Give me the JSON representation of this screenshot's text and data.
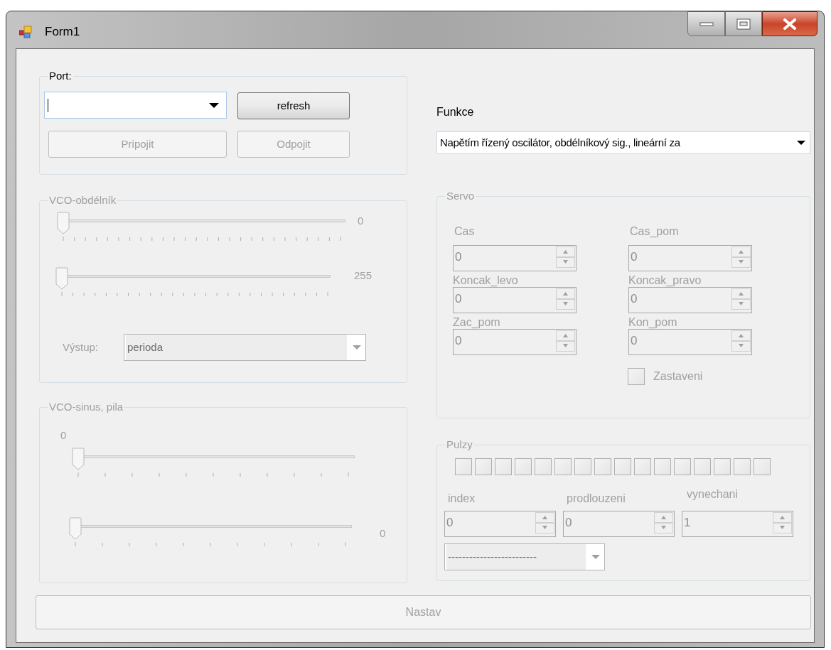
{
  "window": {
    "title": "Form1"
  },
  "port": {
    "title": "Port:",
    "disabled": false,
    "buttons": [
      {
        "label": "refresh",
        "disabled": false
      },
      {
        "label": "Pripojit",
        "disabled": true
      },
      {
        "label": "Odpojit",
        "disabled": true
      }
    ]
  },
  "vco_rect": {
    "title": "VCO-obdélník",
    "disabled": true,
    "sliders": [
      {
        "level": 0,
        "reading": "0"
      },
      {
        "level": 0,
        "reading": "255"
      }
    ],
    "output_label": "Výstup:",
    "output_value": "perioda"
  },
  "vco_sine": {
    "title": "VCO-sinus, pila",
    "disabled": true,
    "sliders": [
      {
        "kind": "reading-above",
        "level": 0,
        "reading": "0"
      },
      {
        "kind": "reading-right",
        "level": 0,
        "reading": "0"
      }
    ]
  },
  "funkce": {
    "label": "Funkce",
    "value": "Napětím řízený oscilátor, obdélníkový sig., lineární za"
  },
  "servo": {
    "title": "Servo",
    "disabled": true,
    "fields": [
      {
        "label": "Cas",
        "value": "0"
      },
      {
        "label": "Cas_pom",
        "value": "0"
      },
      {
        "label": "Koncak_levo",
        "value": "0"
      },
      {
        "label": "Koncak_pravo",
        "value": "0"
      },
      {
        "label": "Zac_pom",
        "value": "0"
      },
      {
        "label": "Kon_pom",
        "value": "0"
      }
    ],
    "checkbox": {
      "label": "Zastaveni",
      "checked": false
    }
  },
  "pulzy": {
    "title": "Pulzy",
    "disabled": true,
    "bits": [
      {
        "checked": false
      },
      {
        "checked": false
      },
      {
        "checked": false
      },
      {
        "checked": false
      },
      {
        "checked": false
      },
      {
        "checked": false
      },
      {
        "checked": false
      },
      {
        "checked": false
      },
      {
        "checked": false
      },
      {
        "checked": false
      },
      {
        "checked": false
      },
      {
        "checked": false
      },
      {
        "checked": false
      },
      {
        "checked": false
      },
      {
        "checked": false
      },
      {
        "checked": false
      }
    ],
    "fields": [
      {
        "label": "index",
        "value": "0"
      },
      {
        "label": "prodlouzeni",
        "value": "0"
      },
      {
        "label": "vynechani",
        "value": "1"
      }
    ],
    "combo_value": "-------------------------"
  },
  "nastav": {
    "label": "Nastav",
    "disabled": true
  }
}
